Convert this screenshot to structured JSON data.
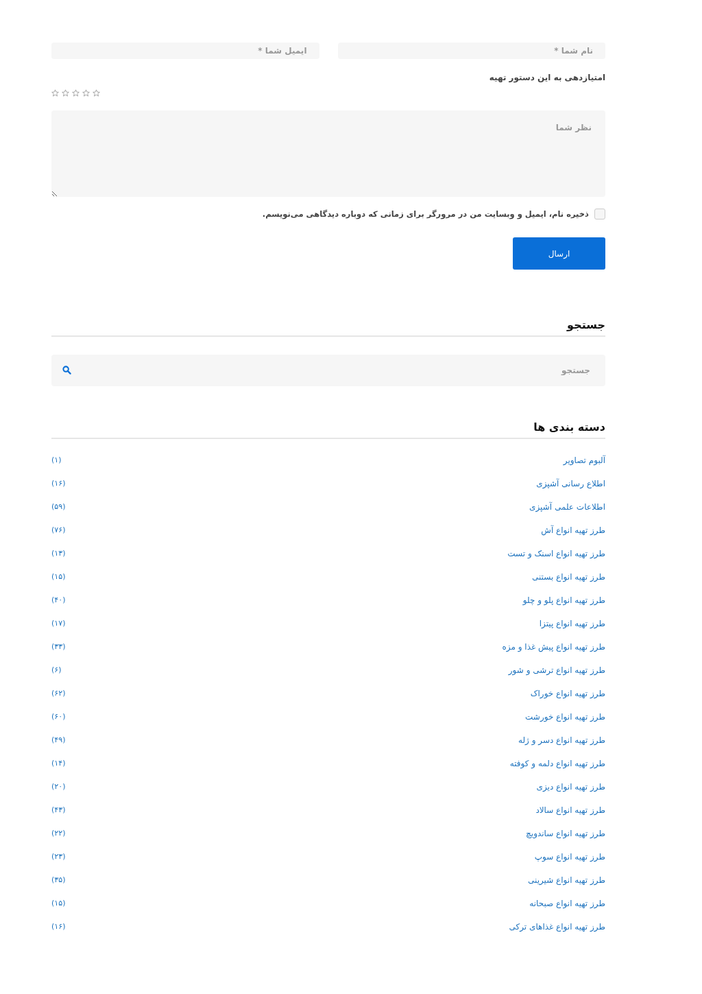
{
  "comment_form": {
    "name_field": {
      "placeholder": "نام شما *"
    },
    "email_field": {
      "placeholder": "ایمیل شما *"
    },
    "rating_label": "امتیازدهی به این دستور تهیه",
    "rating": {
      "stars": 0
    },
    "comment_field": {
      "placeholder": "نظر شما"
    },
    "remember": {
      "label": "ذخیره نام، ایمیل و وبسایت من در مرورگر برای زمانی که دوباره دیدگاهی می‌نویسم.",
      "checked": false
    },
    "submit": "ارسال"
  },
  "search_widget": {
    "title": "جستجو",
    "placeholder": "جستجو"
  },
  "categories": {
    "title": "دسته بندی ها",
    "items": [
      {
        "name": "آلبوم تصاویر",
        "count": "(۱)"
      },
      {
        "name": "اطلاع رسانی آشپزی",
        "count": "(۱۶)"
      },
      {
        "name": "اطلاعات علمی آشپزی",
        "count": "(۵۹)"
      },
      {
        "name": "طرز تهیه انواع آش",
        "count": "(۷۶)"
      },
      {
        "name": "طرز تهیه انواع اسنک و تست",
        "count": "(۱۳)"
      },
      {
        "name": "طرز تهیه انواع بستنی",
        "count": "(۱۵)"
      },
      {
        "name": "طرز تهیه انواع پلو و چلو",
        "count": "(۴۰)"
      },
      {
        "name": "طرز تهیه انواع پیتزا",
        "count": "(۱۷)"
      },
      {
        "name": "طرز تهیه انواع پیش غذا و مزه",
        "count": "(۳۳)"
      },
      {
        "name": "طرز تهیه انواع ترشی و شور",
        "count": "(۶)"
      },
      {
        "name": "طرز تهیه انواع خوراک",
        "count": "(۶۲)"
      },
      {
        "name": "طرز تهیه انواع خورشت",
        "count": "(۶۰)"
      },
      {
        "name": "طرز تهیه انواع دسر و ژله",
        "count": "(۴۹)"
      },
      {
        "name": "طرز تهیه انواع دلمه و کوفته",
        "count": "(۱۴)"
      },
      {
        "name": "طرز تهیه انواع دیزی",
        "count": "(۲۰)"
      },
      {
        "name": "طرز تهیه انواع سالاد",
        "count": "(۴۳)"
      },
      {
        "name": "طرز تهیه انواع ساندویچ",
        "count": "(۲۲)"
      },
      {
        "name": "طرز تهیه انواع سوپ",
        "count": "(۲۳)"
      },
      {
        "name": "طرز تهیه انواع شیرینی",
        "count": "(۳۵)"
      },
      {
        "name": "طرز تهیه انواع صبحانه",
        "count": "(۱۵)"
      },
      {
        "name": "طرز تهیه انواع غذاهای ترکی",
        "count": "(۱۶)"
      }
    ]
  }
}
